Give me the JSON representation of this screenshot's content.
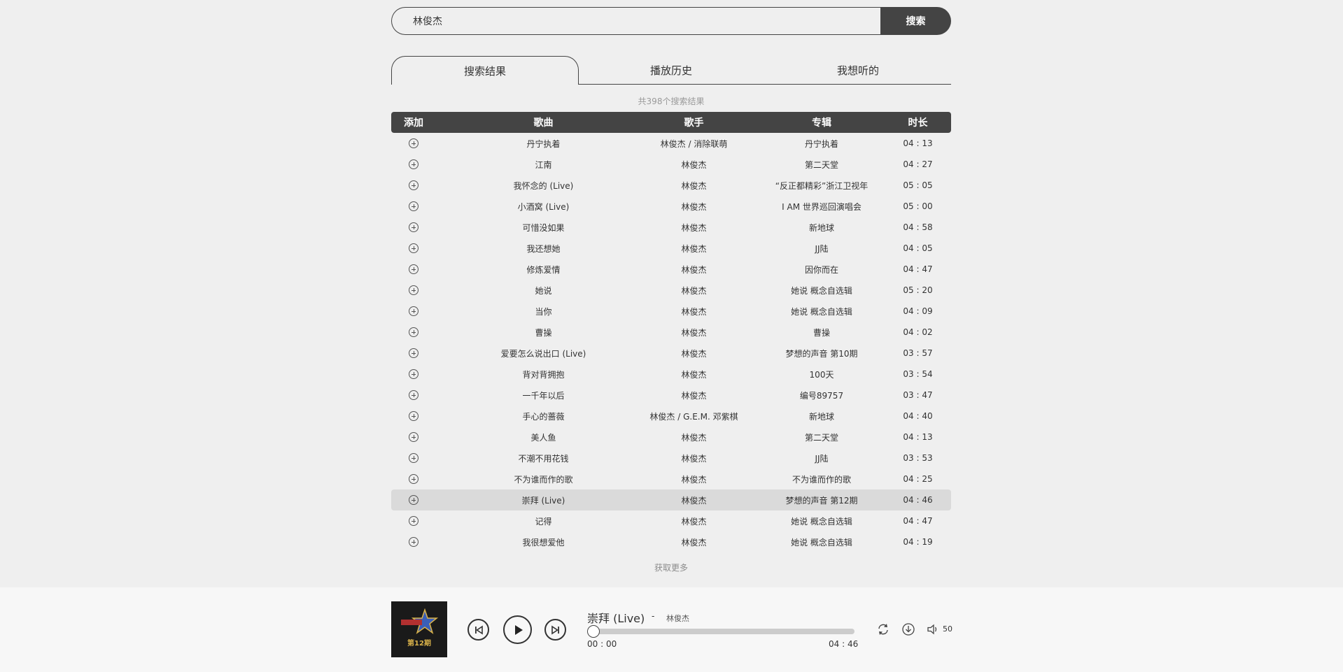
{
  "search": {
    "value": "林俊杰",
    "button_label": "搜索"
  },
  "tabs": [
    {
      "label": "搜索结果",
      "active": true
    },
    {
      "label": "播放历史",
      "active": false
    },
    {
      "label": "我想听的",
      "active": false
    }
  ],
  "result_count": "共398个搜索结果",
  "table": {
    "headers": {
      "add": "添加",
      "song": "歌曲",
      "singer": "歌手",
      "album": "专辑",
      "duration": "时长"
    },
    "rows": [
      {
        "song": "丹宁执着",
        "singer": "林俊杰 / 消除联萌",
        "album": "丹宁执着",
        "duration": "04 : 13"
      },
      {
        "song": "江南",
        "singer": "林俊杰",
        "album": "第二天堂",
        "duration": "04 : 27"
      },
      {
        "song": "我怀念的 (Live)",
        "singer": "林俊杰",
        "album": "“反正都精彩”浙江卫视年",
        "duration": "05 : 05"
      },
      {
        "song": "小酒窝 (Live)",
        "singer": "林俊杰",
        "album": "I AM 世界巡回演唱会",
        "duration": "05 : 00"
      },
      {
        "song": "可惜没如果",
        "singer": "林俊杰",
        "album": "新地球",
        "duration": "04 : 58"
      },
      {
        "song": "我还想她",
        "singer": "林俊杰",
        "album": "JJ陆",
        "duration": "04 : 05"
      },
      {
        "song": "修炼爱情",
        "singer": "林俊杰",
        "album": "因你而在",
        "duration": "04 : 47"
      },
      {
        "song": "她说",
        "singer": "林俊杰",
        "album": "她说 概念自选辑",
        "duration": "05 : 20"
      },
      {
        "song": "当你",
        "singer": "林俊杰",
        "album": "她说 概念自选辑",
        "duration": "04 : 09"
      },
      {
        "song": "曹操",
        "singer": "林俊杰",
        "album": "曹操",
        "duration": "04 : 02"
      },
      {
        "song": "爱要怎么说出口 (Live)",
        "singer": "林俊杰",
        "album": "梦想的声音 第10期",
        "duration": "03 : 57"
      },
      {
        "song": "背对背拥抱",
        "singer": "林俊杰",
        "album": "100天",
        "duration": "03 : 54"
      },
      {
        "song": "一千年以后",
        "singer": "林俊杰",
        "album": "编号89757",
        "duration": "03 : 47"
      },
      {
        "song": "手心的蔷薇",
        "singer": "林俊杰 / G.E.M. 邓紫棋",
        "album": "新地球",
        "duration": "04 : 40"
      },
      {
        "song": "美人鱼",
        "singer": "林俊杰",
        "album": "第二天堂",
        "duration": "04 : 13"
      },
      {
        "song": "不潮不用花钱",
        "singer": "林俊杰",
        "album": "JJ陆",
        "duration": "03 : 53"
      },
      {
        "song": "不为谁而作的歌",
        "singer": "林俊杰",
        "album": "不为谁而作的歌",
        "duration": "04 : 25"
      },
      {
        "song": "崇拜 (Live)",
        "singer": "林俊杰",
        "album": "梦想的声音 第12期",
        "duration": "04 : 46",
        "active": true
      },
      {
        "song": "记得",
        "singer": "林俊杰",
        "album": "她说 概念自选辑",
        "duration": "04 : 47"
      },
      {
        "song": "我很想爱他",
        "singer": "林俊杰",
        "album": "她说 概念自选辑",
        "duration": "04 : 19"
      }
    ]
  },
  "load_more": "获取更多",
  "player": {
    "cover_caption": "第12期",
    "title": "崇拜 (Live)",
    "separator": "-",
    "artist": "林俊杰",
    "current_time": "00 : 00",
    "total_time": "04 : 46",
    "progress": 0,
    "volume": "50",
    "icons": [
      "previous-icon",
      "play-icon",
      "next-icon",
      "loop-icon",
      "download-icon",
      "volume-icon"
    ]
  }
}
